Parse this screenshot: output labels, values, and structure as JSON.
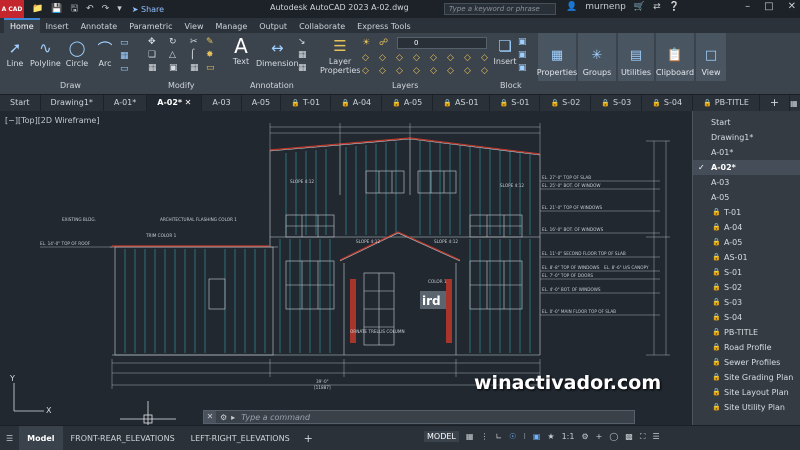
{
  "titlebar": {
    "logo": "A CAD",
    "share": "Share",
    "window_title": "Autodesk AutoCAD 2023   A-02.dwg",
    "search_placeholder": "Type a keyword or phrase",
    "user": "murnenp"
  },
  "ribbon_tabs": [
    "Home",
    "Insert",
    "Annotate",
    "Parametric",
    "View",
    "Manage",
    "Output",
    "Collaborate",
    "Express Tools"
  ],
  "ribbon": {
    "draw": {
      "tools": [
        "Line",
        "Polyline",
        "Circle",
        "Arc"
      ],
      "label": "Draw"
    },
    "modify": {
      "label": "Modify"
    },
    "annotation": {
      "tools": [
        "Text",
        "Dimension"
      ],
      "label": "Annotation"
    },
    "layers": {
      "tool": "Layer Properties",
      "current_layer": "0",
      "label": "Layers"
    },
    "block": {
      "tool": "Insert",
      "label": "Block"
    },
    "buttons": [
      "Properties",
      "Groups",
      "Utilities",
      "Clipboard",
      "View"
    ]
  },
  "file_tabs": [
    {
      "label": "Start",
      "locked": false
    },
    {
      "label": "Drawing1*",
      "locked": false
    },
    {
      "label": "A-01*",
      "locked": false
    },
    {
      "label": "A-02*",
      "locked": false,
      "active": true
    },
    {
      "label": "A-03",
      "locked": false
    },
    {
      "label": "A-05",
      "locked": false
    },
    {
      "label": "T-01",
      "locked": true
    },
    {
      "label": "A-04",
      "locked": true
    },
    {
      "label": "A-05",
      "locked": true
    },
    {
      "label": "AS-01",
      "locked": true
    },
    {
      "label": "S-01",
      "locked": true
    },
    {
      "label": "S-02",
      "locked": true
    },
    {
      "label": "S-03",
      "locked": true
    },
    {
      "label": "S-04",
      "locked": true
    },
    {
      "label": "PB-TITLE",
      "locked": true
    }
  ],
  "viewport_label": "[−][Top][2D Wireframe]",
  "drawing": {
    "slope_left": "SLOPE 4:12",
    "slope_right": "SLOPE 4:12",
    "slope_canopy_l": "SLOPE 4:12",
    "slope_canopy_r": "SLOPE 4:12",
    "existing_bldg": "EXISTING BLDG.",
    "arch_fastener": "ARCHITECTURAL FLASHING COLOR 1",
    "trim_color": "TRIM COLOR 1",
    "top_of_roof": "EL. 14'-0\" TOP OF ROOF",
    "elevations": [
      "EL. 27'-0\" TOP OF SLAB",
      "EL. 25'-0\" BOT. OF WINDOW",
      "EL. 21'-0\" TOP OF WINDOWS",
      "EL. 16'-0\" BOT. OF WINDOWS",
      "EL. 11'-0\" SECOND FLOOR TOP OF SLAB",
      "EL. 8'-8\" TOP OF WINDOWS",
      "EL. 7'-0\" TOP OF DOORS",
      "EL. 4'-0\" BOT. OF WINDOWS",
      "EL. 0'-0\" MAIN FLOOR TOP OF SLAB"
    ],
    "canopy_note": "EL. 8'-6\" U/S CANOPY",
    "color_note": "COLOR 1",
    "column_note": "ORNATE TRELLIS COLUMN",
    "overall_dim": "39'-0\"",
    "overall_dim_mm": "[11887]",
    "logo_text": "ird"
  },
  "layout_list": [
    {
      "label": "Start",
      "locked": false
    },
    {
      "label": "Drawing1*",
      "locked": false
    },
    {
      "label": "A-01*",
      "locked": false
    },
    {
      "label": "A-02*",
      "locked": false,
      "selected": true
    },
    {
      "label": "A-03",
      "locked": false
    },
    {
      "label": "A-05",
      "locked": false
    },
    {
      "label": "T-01",
      "locked": true
    },
    {
      "label": "A-04",
      "locked": true
    },
    {
      "label": "A-05",
      "locked": true
    },
    {
      "label": "AS-01",
      "locked": true
    },
    {
      "label": "S-01",
      "locked": true
    },
    {
      "label": "S-02",
      "locked": true
    },
    {
      "label": "S-03",
      "locked": true
    },
    {
      "label": "S-04",
      "locked": true
    },
    {
      "label": "PB-TITLE",
      "locked": true
    },
    {
      "label": "Road Profile",
      "locked": true
    },
    {
      "label": "Sewer Profiles",
      "locked": true
    },
    {
      "label": "Site Grading Plan",
      "locked": true
    },
    {
      "label": "Site Layout Plan",
      "locked": true
    },
    {
      "label": "Site Utility Plan",
      "locked": true
    }
  ],
  "watermark": "winactivador.com",
  "command": {
    "prompt": "Type a command"
  },
  "status": {
    "layout_tabs": [
      "Model",
      "FRONT-REAR_ELEVATIONS",
      "LEFT-RIGHT_ELEVATIONS"
    ],
    "model_button": "MODEL",
    "scale": "1:1"
  },
  "colors": {
    "accent": "#3f8ad8",
    "elevation_lines": "#3fb6c8",
    "accent_red": "#c0392b"
  }
}
